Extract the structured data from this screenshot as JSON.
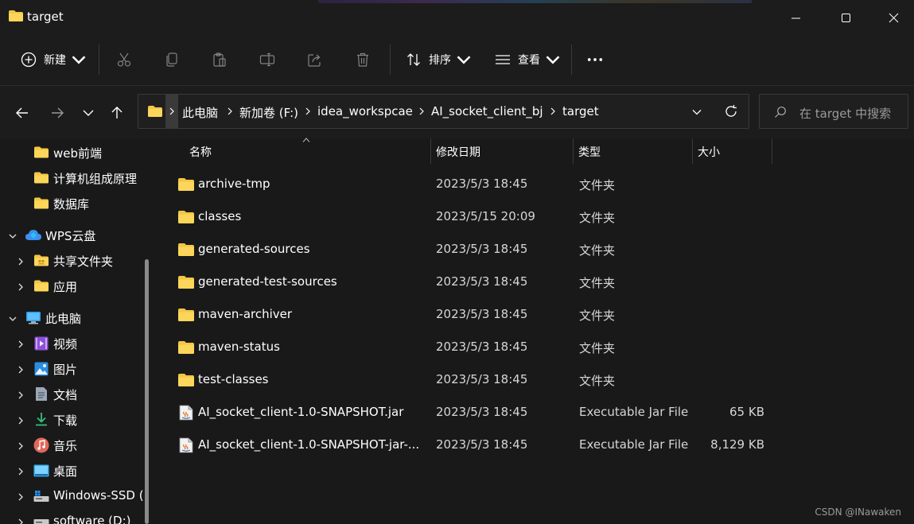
{
  "window": {
    "title": "target",
    "icons": {
      "app": "folder-icon",
      "minimize": "minimize-icon",
      "maximize": "maximize-icon",
      "close": "close-icon"
    }
  },
  "toolbar": {
    "new_label": "新建",
    "sort_label": "排序",
    "view_label": "查看",
    "icons": [
      "plus-circle-icon",
      "cut-icon",
      "copy-icon",
      "paste-icon",
      "rename-icon",
      "share-icon",
      "delete-icon",
      "sort-icon",
      "view-icon",
      "more-icon"
    ]
  },
  "navigation": {
    "breadcrumb": [
      "此电脑",
      "新加卷 (F:)",
      "idea_workspcae",
      "AI_socket_client_bj",
      "target"
    ],
    "search_placeholder": "在 target 中搜索"
  },
  "sidebar": {
    "items": [
      {
        "label": "web前端",
        "icon": "folder-icon"
      },
      {
        "label": "计算机组成原理",
        "icon": "folder-icon"
      },
      {
        "label": "数据库",
        "icon": "folder-icon"
      },
      {
        "label": "WPS云盘",
        "icon": "cloud-icon"
      },
      {
        "label": "共享文件夹",
        "icon": "shared-folder-icon"
      },
      {
        "label": "应用",
        "icon": "folder-icon"
      },
      {
        "label": "此电脑",
        "icon": "computer-icon"
      },
      {
        "label": "视频",
        "icon": "video-icon"
      },
      {
        "label": "图片",
        "icon": "picture-icon"
      },
      {
        "label": "文档",
        "icon": "document-icon"
      },
      {
        "label": "下载",
        "icon": "download-icon"
      },
      {
        "label": "音乐",
        "icon": "music-icon"
      },
      {
        "label": "桌面",
        "icon": "desktop-icon"
      },
      {
        "label": "Windows-SSD (",
        "icon": "drive-icon"
      },
      {
        "label": "software (D:)",
        "icon": "drive-icon"
      }
    ]
  },
  "columns": {
    "name": "名称",
    "date": "修改日期",
    "type": "类型",
    "size": "大小"
  },
  "files": [
    {
      "name": "archive-tmp",
      "date": "2023/5/3 18:45",
      "type": "文件夹",
      "size": "",
      "icon": "folder-icon"
    },
    {
      "name": "classes",
      "date": "2023/5/15 20:09",
      "type": "文件夹",
      "size": "",
      "icon": "folder-icon"
    },
    {
      "name": "generated-sources",
      "date": "2023/5/3 18:45",
      "type": "文件夹",
      "size": "",
      "icon": "folder-icon"
    },
    {
      "name": "generated-test-sources",
      "date": "2023/5/3 18:45",
      "type": "文件夹",
      "size": "",
      "icon": "folder-icon"
    },
    {
      "name": "maven-archiver",
      "date": "2023/5/3 18:45",
      "type": "文件夹",
      "size": "",
      "icon": "folder-icon"
    },
    {
      "name": "maven-status",
      "date": "2023/5/3 18:45",
      "type": "文件夹",
      "size": "",
      "icon": "folder-icon"
    },
    {
      "name": "test-classes",
      "date": "2023/5/3 18:45",
      "type": "文件夹",
      "size": "",
      "icon": "folder-icon"
    },
    {
      "name": "AI_socket_client-1.0-SNAPSHOT.jar",
      "date": "2023/5/3 18:45",
      "type": "Executable Jar File",
      "size": "65 KB",
      "icon": "jar-file-icon"
    },
    {
      "name": "AI_socket_client-1.0-SNAPSHOT-jar-...",
      "date": "2023/5/3 18:45",
      "type": "Executable Jar File",
      "size": "8,129 KB",
      "icon": "jar-file-icon"
    }
  ],
  "watermark": "CSDN @INawaken",
  "colors": {
    "background": "#191919",
    "chrome": "#1c1c1c",
    "folder": "#f3c744",
    "text": "#ffffff"
  }
}
